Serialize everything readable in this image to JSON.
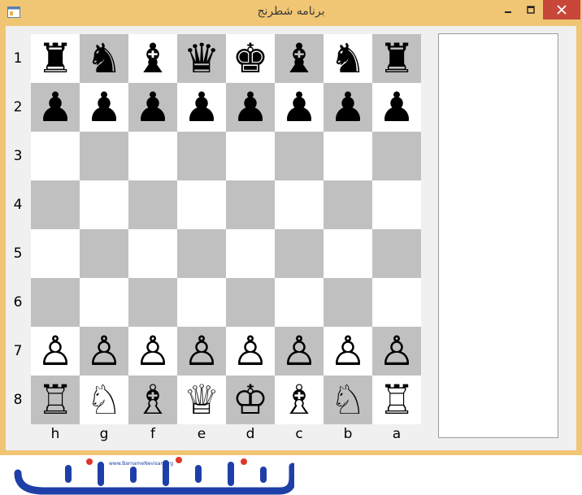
{
  "window": {
    "title": "برنامه شطرنج",
    "colors": {
      "frame": "#f0c674",
      "close": "#c8473a",
      "light_square": "#ffffff",
      "dark_square": "#c0c0c0"
    }
  },
  "board": {
    "rank_labels": [
      "1",
      "2",
      "3",
      "4",
      "5",
      "6",
      "7",
      "8"
    ],
    "file_labels": [
      "h",
      "g",
      "f",
      "e",
      "d",
      "c",
      "b",
      "a"
    ],
    "rows": [
      [
        "♜",
        "♞",
        "♝",
        "♛",
        "♚",
        "♝",
        "♞",
        "♜"
      ],
      [
        "♟",
        "♟",
        "♟",
        "♟",
        "♟",
        "♟",
        "♟",
        "♟"
      ],
      [
        "",
        "",
        "",
        "",
        "",
        "",
        "",
        ""
      ],
      [
        "",
        "",
        "",
        "",
        "",
        "",
        "",
        ""
      ],
      [
        "",
        "",
        "",
        "",
        "",
        "",
        "",
        ""
      ],
      [
        "",
        "",
        "",
        "",
        "",
        "",
        "",
        ""
      ],
      [
        "♙",
        "♙",
        "♙",
        "♙",
        "♙",
        "♙",
        "♙",
        "♙"
      ],
      [
        "♖",
        "♘",
        "♗",
        "♕",
        "♔",
        "♗",
        "♘",
        "♖"
      ]
    ]
  },
  "logo": {
    "url_text": "www.BarnameNevisan.org",
    "brand_text": "برنامه نویسان"
  }
}
